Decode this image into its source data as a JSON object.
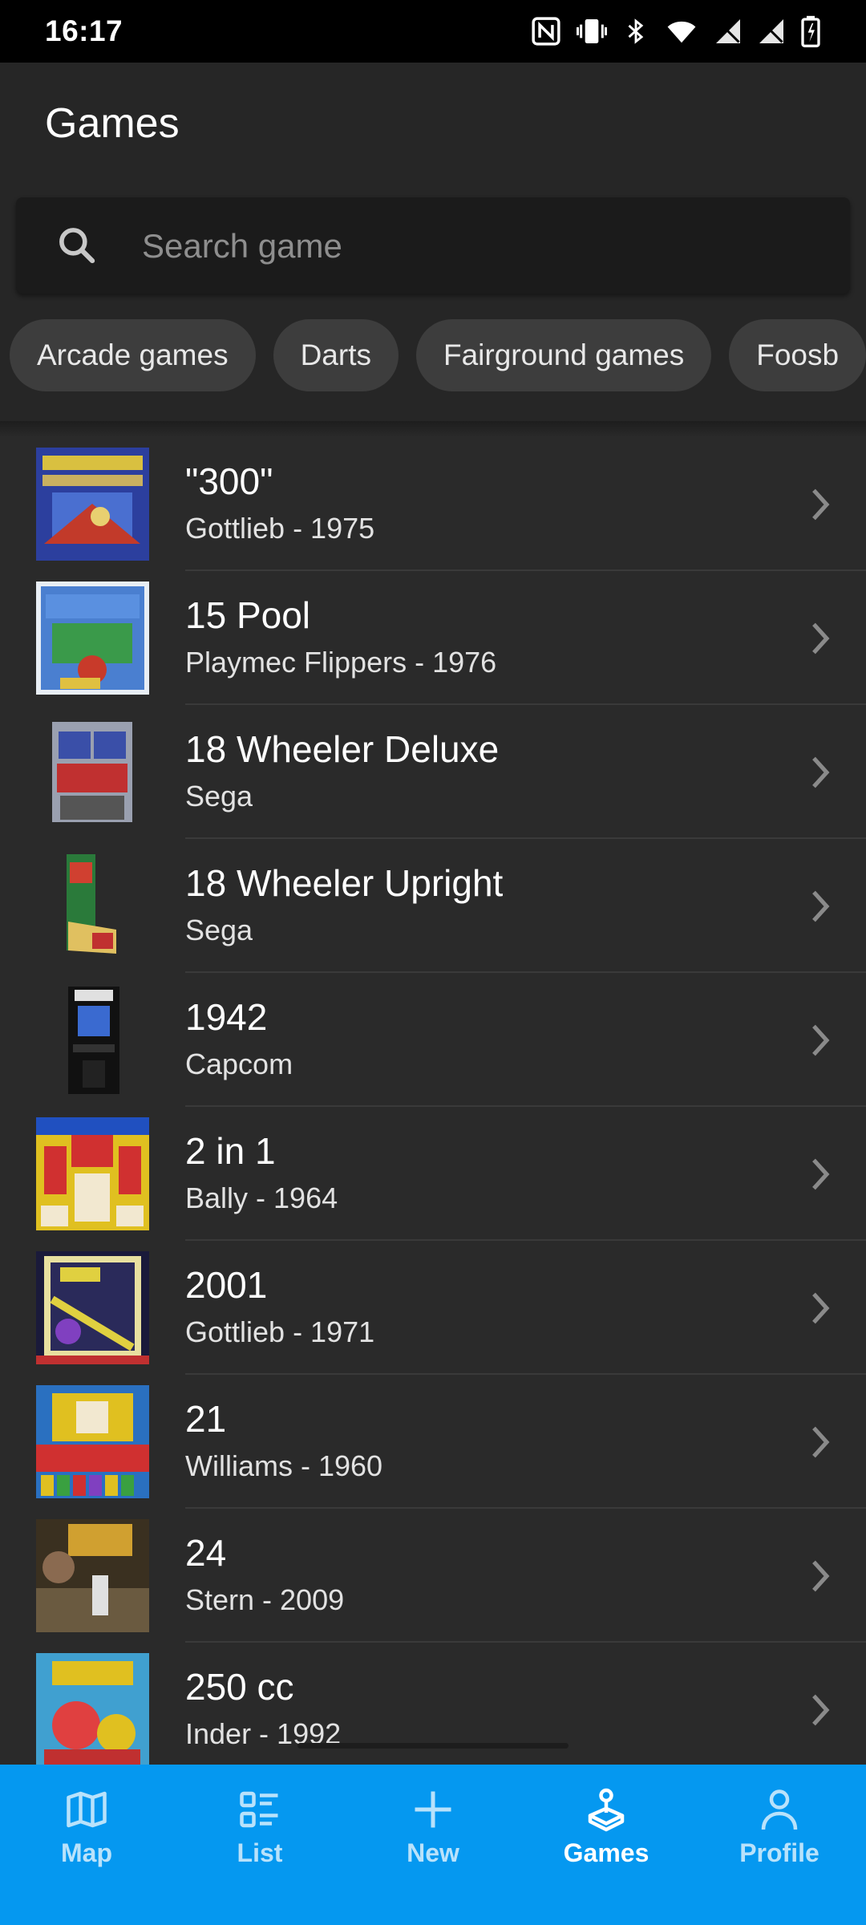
{
  "status_bar": {
    "time": "16:17",
    "icons": [
      "nfc-icon",
      "vibrate-icon",
      "bluetooth-icon",
      "wifi-icon",
      "signal-icon",
      "signal-icon-2",
      "battery-icon"
    ]
  },
  "header": {
    "title": "Games"
  },
  "search": {
    "placeholder": "Search game",
    "value": ""
  },
  "chips": [
    {
      "label": "Arcade games"
    },
    {
      "label": "Darts"
    },
    {
      "label": "Fairground games"
    },
    {
      "label": "Foosb"
    }
  ],
  "games": [
    {
      "title": "\"300\"",
      "subtitle": "Gottlieb - 1975",
      "thumb_colors": [
        "#2c3f9e",
        "#d9c040",
        "#c23a2a"
      ]
    },
    {
      "title": "15 Pool",
      "subtitle": "Playmec Flippers - 1976",
      "thumb_colors": [
        "#4a7fd0",
        "#e0c040",
        "#c83a2a"
      ]
    },
    {
      "title": "18 Wheeler Deluxe",
      "subtitle": "Sega",
      "thumb_colors": [
        "#3a4fa8",
        "#c03030",
        "#9aa0b0"
      ]
    },
    {
      "title": "18 Wheeler Upright",
      "subtitle": "Sega",
      "thumb_colors": [
        "#2a7a3a",
        "#d04030",
        "#e0c060"
      ]
    },
    {
      "title": "1942",
      "subtitle": "Capcom",
      "thumb_colors": [
        "#111111",
        "#3a6ad0",
        "#e0e0e0"
      ]
    },
    {
      "title": "2 in 1",
      "subtitle": "Bally - 1964",
      "thumb_colors": [
        "#e0c020",
        "#d03030",
        "#2050c0"
      ]
    },
    {
      "title": "2001",
      "subtitle": "Gottlieb - 1971",
      "thumb_colors": [
        "#1a1a3a",
        "#e0d040",
        "#8040c0"
      ]
    },
    {
      "title": "21",
      "subtitle": "Williams - 1960",
      "thumb_colors": [
        "#d03030",
        "#e0c020",
        "#2a70c0"
      ]
    },
    {
      "title": "24",
      "subtitle": "Stern - 2009",
      "thumb_colors": [
        "#3a3020",
        "#d0a030",
        "#6a5a40"
      ]
    },
    {
      "title": "250 cc",
      "subtitle": "Inder - 1992",
      "thumb_colors": [
        "#40a0d0",
        "#e04040",
        "#e0c020"
      ]
    }
  ],
  "bottom_nav": {
    "items": [
      {
        "label": "Map",
        "icon": "map-icon"
      },
      {
        "label": "List",
        "icon": "list-icon"
      },
      {
        "label": "New",
        "icon": "plus-icon"
      },
      {
        "label": "Games",
        "icon": "joystick-icon",
        "active": true
      },
      {
        "label": "Profile",
        "icon": "person-icon"
      }
    ],
    "background": "#0598f0"
  },
  "colors": {
    "accent": "#0598f0",
    "background": "#2a2a2a",
    "header": "#262626"
  }
}
